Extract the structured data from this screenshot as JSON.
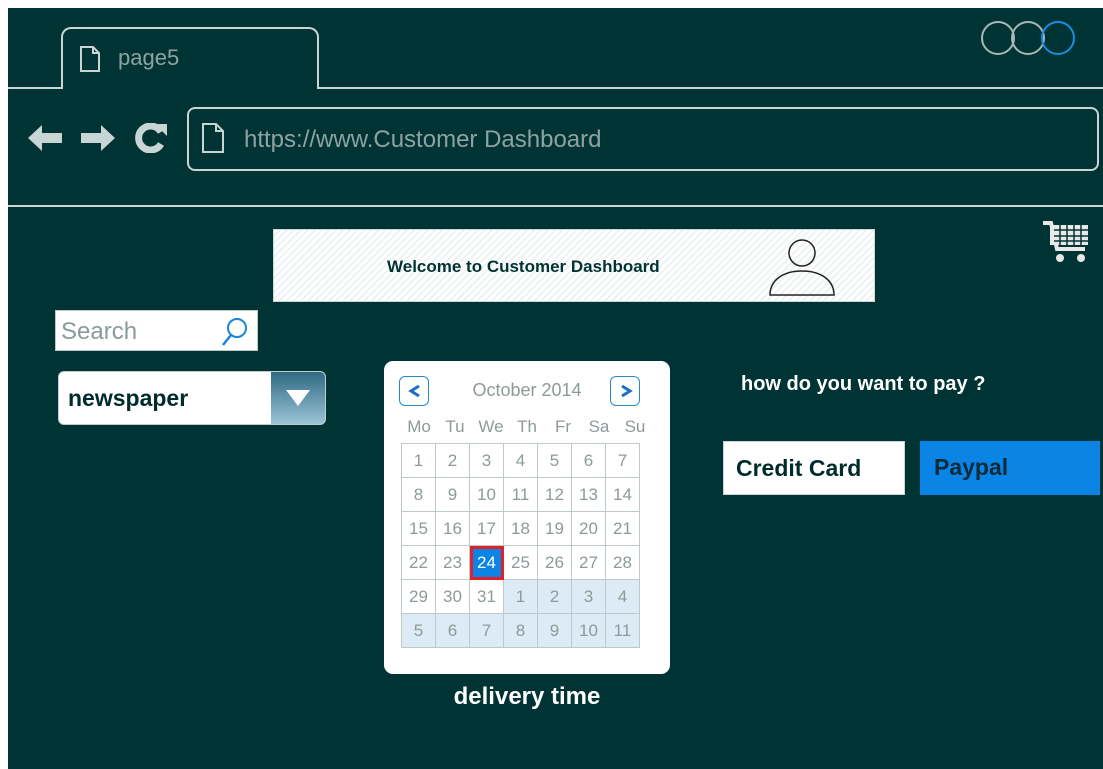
{
  "browser": {
    "tab_label": "page5",
    "url": "https://www.Customer Dashboard"
  },
  "header": {
    "welcome": "Welcome to Customer Dashboard"
  },
  "search": {
    "placeholder": "Search"
  },
  "category_select": {
    "selected": "newspaper"
  },
  "calendar": {
    "month_label": "October 2014",
    "weekdays": [
      "Mo",
      "Tu",
      "We",
      "Th",
      "Fr",
      "Sa",
      "Su"
    ],
    "weeks": [
      [
        "1",
        "2",
        "3",
        "4",
        "5",
        "6",
        "7"
      ],
      [
        "8",
        "9",
        "10",
        "11",
        "12",
        "13",
        "14"
      ],
      [
        "15",
        "16",
        "17",
        "18",
        "19",
        "20",
        "21"
      ],
      [
        "22",
        "23",
        "24",
        "25",
        "26",
        "27",
        "28"
      ],
      [
        "29",
        "30",
        "31",
        "1",
        "2",
        "3",
        "4"
      ],
      [
        "5",
        "6",
        "7",
        "8",
        "9",
        "10",
        "11"
      ]
    ],
    "selected_day": "24",
    "caption": "delivery time"
  },
  "payment": {
    "question": "how do you want to pay ?",
    "options": [
      "Credit Card",
      "Paypal"
    ],
    "selected": "Paypal"
  },
  "colors": {
    "background": "#003333",
    "accent": "#0a85e6",
    "selection_border": "#e0202a"
  },
  "icons": [
    "page-icon",
    "back-arrow-icon",
    "forward-arrow-icon",
    "refresh-icon",
    "user-icon",
    "cart-icon",
    "search-icon",
    "chevron-down-icon",
    "chevron-left-icon",
    "chevron-right-icon"
  ]
}
